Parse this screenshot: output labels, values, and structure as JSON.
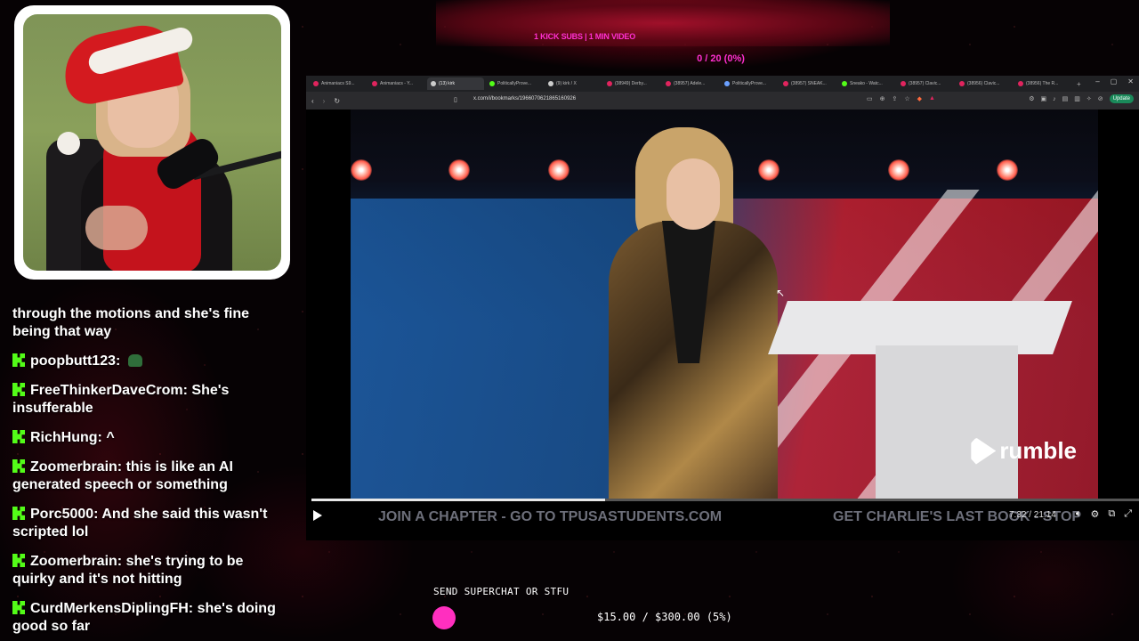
{
  "banner": {
    "text": "1 KICK SUBS | 1 MIN VIDEO",
    "counter": "0 / 20 (0%)"
  },
  "chat": [
    {
      "user": "",
      "text": "through the motions and she's fine being that way",
      "badge": false
    },
    {
      "user": "poopbutt123",
      "text": "",
      "badge": true,
      "emote": "green-emote"
    },
    {
      "user": "FreeThinkerDaveCrom",
      "text": "She's insufferable",
      "badge": true
    },
    {
      "user": "RichHung",
      "text": "^",
      "badge": true
    },
    {
      "user": "Zoomerbrain",
      "text": "this is like an AI generated speech or something",
      "badge": true
    },
    {
      "user": "Porc5000",
      "text": "And she said this wasn't scripted lol",
      "badge": true
    },
    {
      "user": "Zoomerbrain",
      "text": "she's trying to be quirky and it's not hitting",
      "badge": true
    },
    {
      "user": "CurdMerkensDiplingFH",
      "text": "she's doing good so far",
      "badge": true
    }
  ],
  "browser": {
    "tabs": [
      {
        "label": "Animaniacs S9...",
        "color": "#e0245e"
      },
      {
        "label": "Animaniacs - Y...",
        "color": "#e0245e"
      },
      {
        "label": "(13) kirk",
        "color": "#cccccc",
        "active": true
      },
      {
        "label": "PoliticallyProve...",
        "color": "#53fc18"
      },
      {
        "label": "(9) kirk / X",
        "color": "#cccccc"
      },
      {
        "label": "(38949) Derby...",
        "color": "#e0245e"
      },
      {
        "label": "(38957) Adele...",
        "color": "#e0245e"
      },
      {
        "label": "PoliticallyProve...",
        "color": "#6aa0ff"
      },
      {
        "label": "(38957) SNEAK...",
        "color": "#e0245e"
      },
      {
        "label": "Sneako - Watc...",
        "color": "#53fc18"
      },
      {
        "label": "(38957) Clavic...",
        "color": "#e0245e"
      },
      {
        "label": "(38956) Clavic...",
        "color": "#e0245e"
      },
      {
        "label": "(38956) The R...",
        "color": "#e0245e"
      }
    ],
    "url": "x.com/i/bookmarks/1966070621865160926",
    "update_label": "Update"
  },
  "video": {
    "watermark": "rumble",
    "ticker_left": "JOIN A CHAPTER - GO TO TPUSASTUDENTS.COM",
    "ticker_right": "GET CHARLIE'S LAST BOOK - STOP",
    "time": "7:32 / 21:14",
    "progress": 0.355
  },
  "superchat": {
    "label": "SEND SUPERCHAT OR STFU",
    "amount": "$15.00 / $300.00 (5%)",
    "progress": 0.05,
    "color": "#ff2fbf"
  }
}
